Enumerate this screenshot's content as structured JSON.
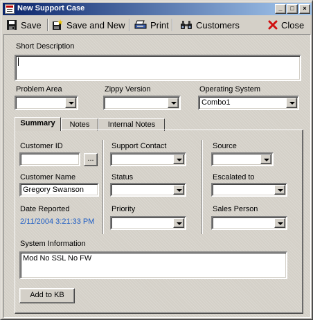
{
  "window": {
    "title": "New Support Case"
  },
  "titlebar_buttons": {
    "minimize": "_",
    "maximize": "□",
    "close": "×"
  },
  "toolbar": {
    "save": "Save",
    "save_new": "Save and New",
    "print": "Print",
    "customers": "Customers",
    "close": "Close"
  },
  "form": {
    "short_description": {
      "label": "Short Description",
      "value": ""
    },
    "problem_area": {
      "label": "Problem Area",
      "value": ""
    },
    "zippy_version": {
      "label": "Zippy Version",
      "value": ""
    },
    "operating_system": {
      "label": "Operating System",
      "value": "Combo1"
    }
  },
  "tabs": [
    {
      "label": "Summary",
      "active": true
    },
    {
      "label": "Notes",
      "active": false
    },
    {
      "label": "Internal Notes",
      "active": false
    }
  ],
  "summary": {
    "customer_id": {
      "label": "Customer ID",
      "value": "",
      "lookup_label": "..."
    },
    "customer_name": {
      "label": "Customer Name",
      "value": "Gregory Swanson"
    },
    "date_reported": {
      "label": "Date Reported",
      "value": "2/11/2004 3:21:33 PM"
    },
    "support_contact": {
      "label": "Support Contact",
      "value": ""
    },
    "status": {
      "label": "Status",
      "value": ""
    },
    "priority": {
      "label": "Priority",
      "value": ""
    },
    "source": {
      "label": "Source",
      "value": ""
    },
    "escalated_to": {
      "label": "Escalated to",
      "value": ""
    },
    "sales_person": {
      "label": "Sales Person",
      "value": ""
    },
    "system_information": {
      "label": "System Information",
      "value": "Mod No SSL No FW"
    },
    "add_to_kb": "Add to KB"
  },
  "colors": {
    "title_start": "#0a246a",
    "title_end": "#a6caf0",
    "date_text": "#1c5cc4",
    "face": "#d4d0c8"
  }
}
